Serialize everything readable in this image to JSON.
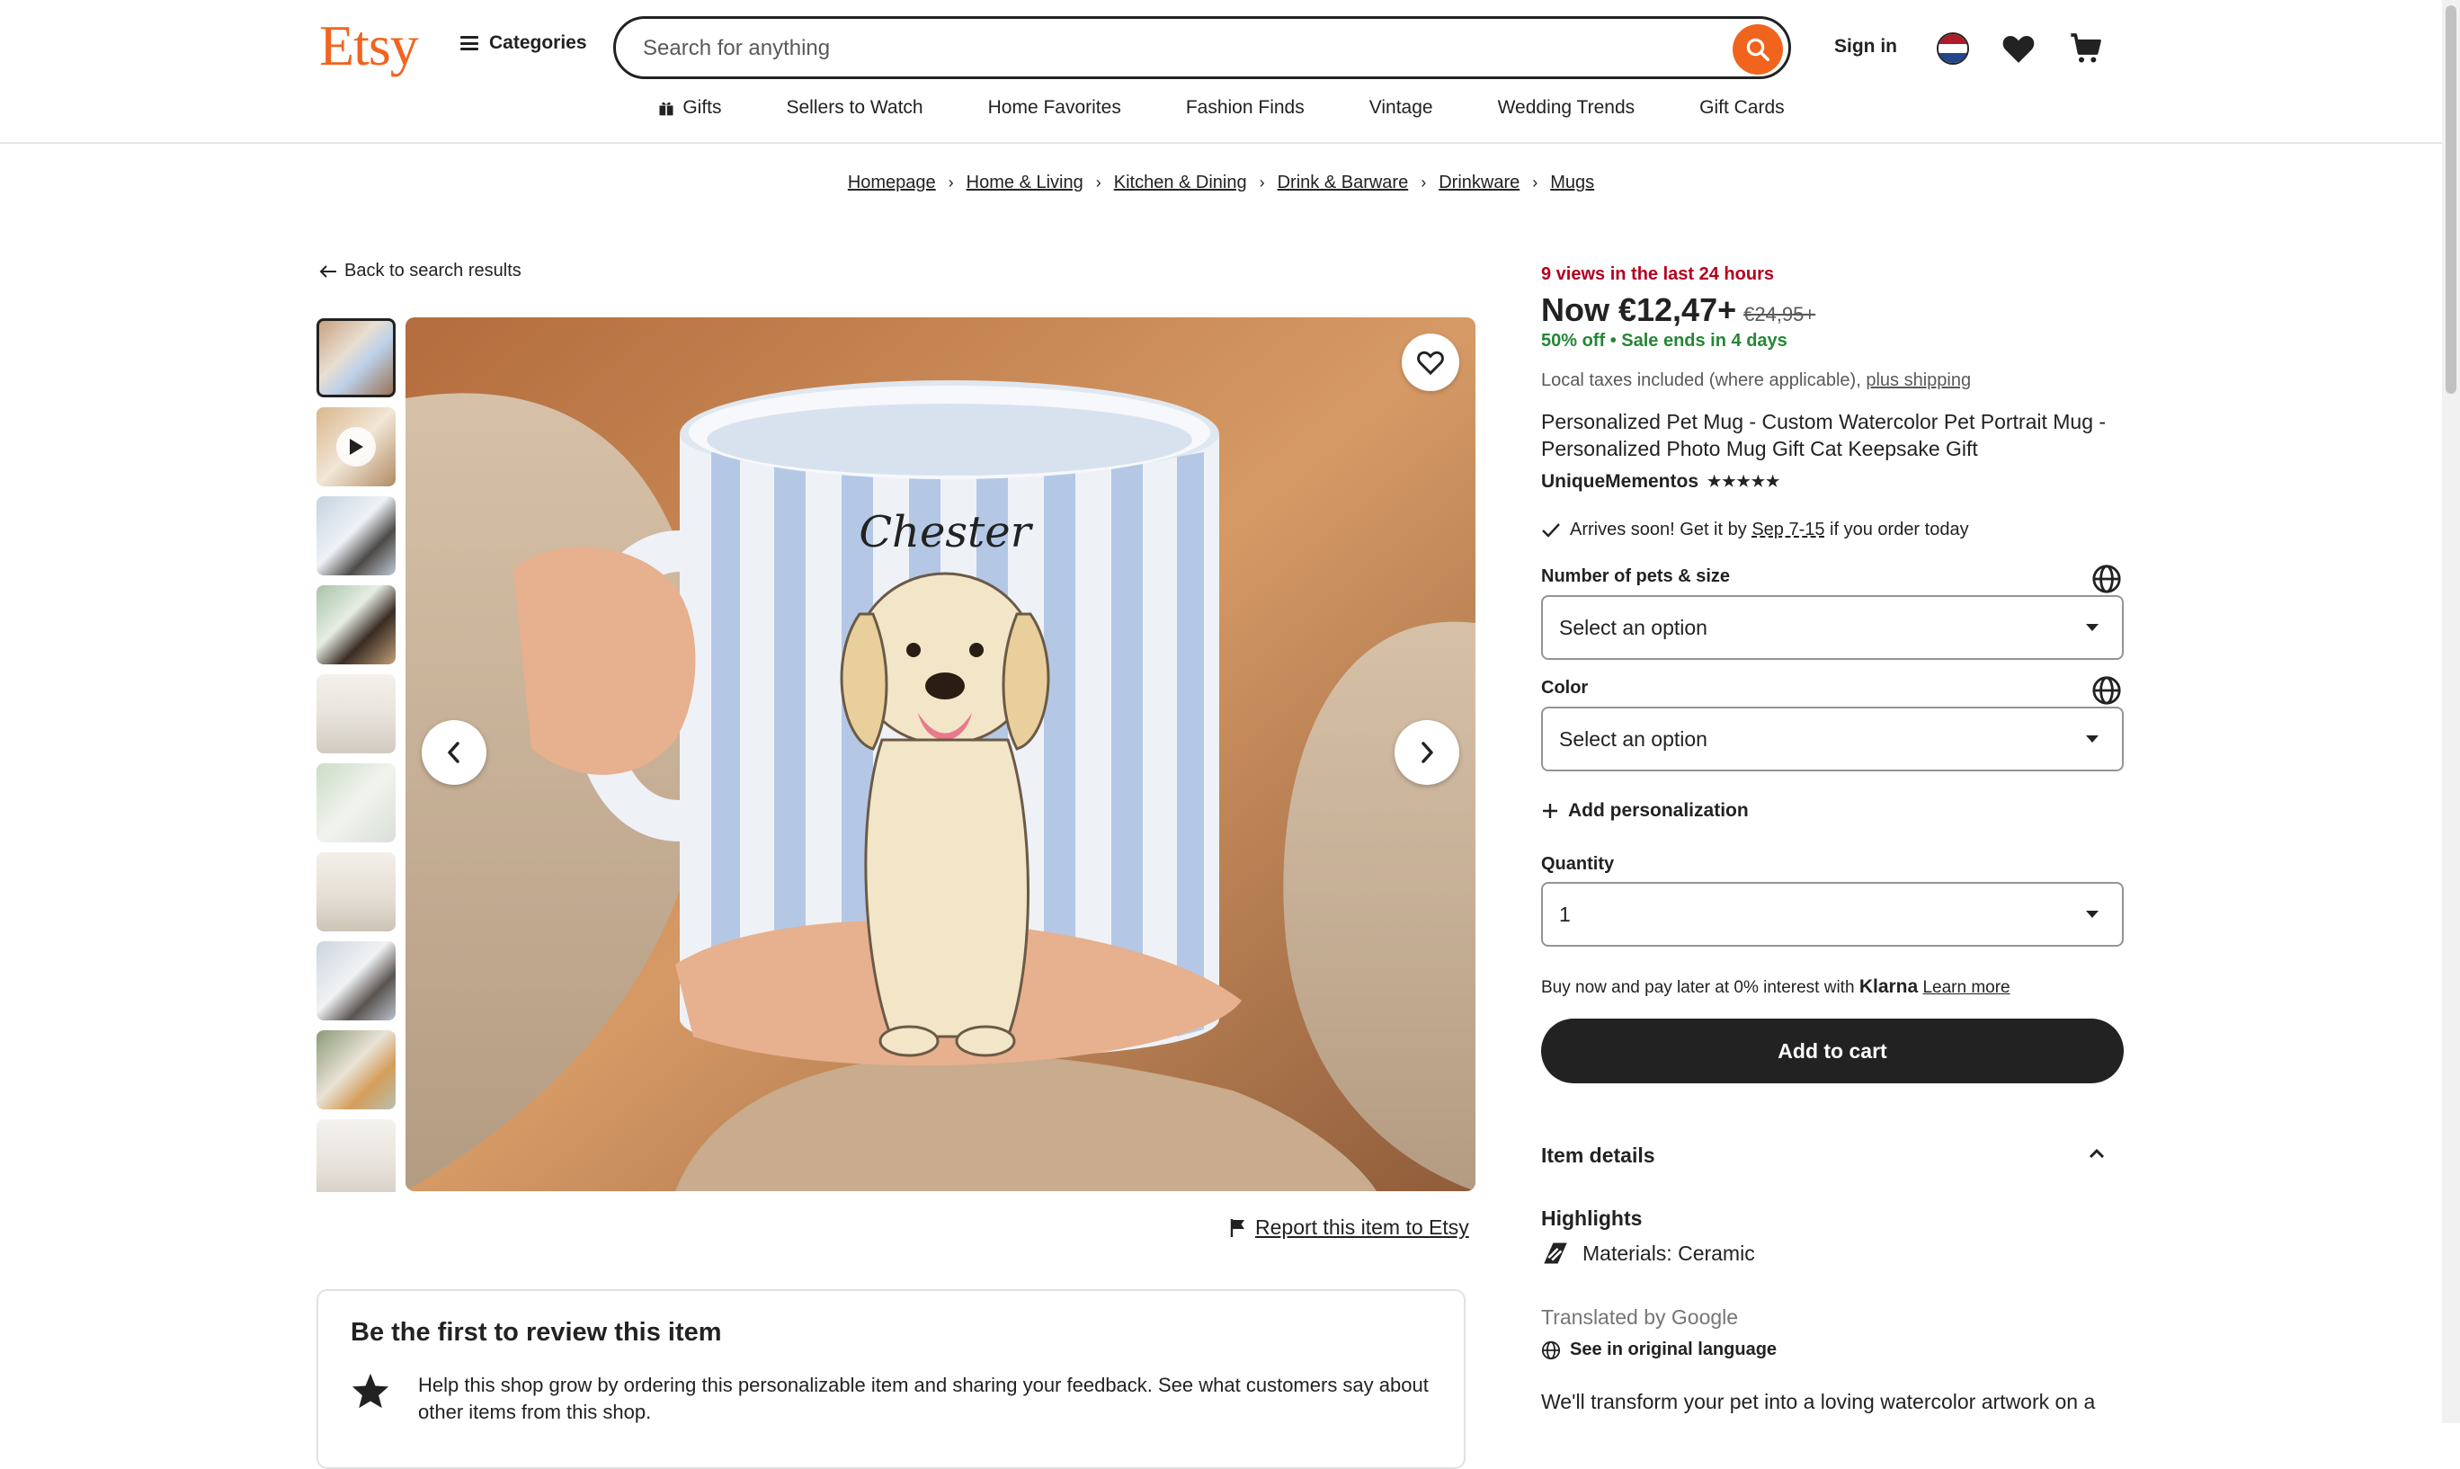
{
  "header": {
    "logo": "Etsy",
    "categories_label": "Categories",
    "search_placeholder": "Search for anything",
    "sign_in": "Sign in"
  },
  "category_nav": [
    "Gifts",
    "Sellers to Watch",
    "Home Favorites",
    "Fashion Finds",
    "Vintage",
    "Wedding Trends",
    "Gift Cards"
  ],
  "breadcrumb": [
    "Homepage",
    "Home & Living",
    "Kitchen & Dining",
    "Drink & Barware",
    "Drinkware",
    "Mugs"
  ],
  "back_link": "Back to search results",
  "gallery": {
    "image_label": "Chester",
    "report_link": "Report this item to Etsy"
  },
  "review": {
    "title": "Be the first to review this item",
    "text": "Help this shop grow by ordering this personalizable item and sharing your feedback. See what customers say about other items from this shop."
  },
  "product": {
    "views": "9 views in the last 24 hours",
    "price_now": "Now €12,47+",
    "price_original": "€24,95+",
    "discount": "50% off",
    "sale_ends": "Sale ends in 4 days",
    "taxes": "Local taxes included (where applicable),",
    "shipping_link": "plus shipping",
    "title": "Personalized Pet Mug - Custom Watercolor Pet Portrait Mug - Personalized Photo Mug Gift Cat Keepsake Gift",
    "shop_name": "UniqueMementos",
    "rating_stars": "★★★★★",
    "arrives_prefix": "Arrives soon! Get it by",
    "arrives_date": "Sep 7-15",
    "arrives_suffix": "if you order today"
  },
  "options": {
    "pets_label": "Number of pets & size",
    "pets_value": "Select an option",
    "color_label": "Color",
    "color_value": "Select an option",
    "add_personalization": "Add personalization",
    "quantity_label": "Quantity",
    "quantity_value": "1"
  },
  "klarna": {
    "text": "Buy now and pay later at 0% interest with",
    "brand": "Klarna",
    "learn_more": "Learn more"
  },
  "add_to_cart": "Add to cart",
  "details": {
    "header": "Item details",
    "highlights": "Highlights",
    "materials": "Materials: Ceramic",
    "translated": "Translated by Google",
    "see_original": "See in original language",
    "description_start": "We'll transform your pet into a loving watercolor artwork on a"
  },
  "colors": {
    "brand_orange": "#f1641e",
    "views_red": "#b3001e",
    "sale_green": "#258635",
    "cart_button": "#222222"
  }
}
